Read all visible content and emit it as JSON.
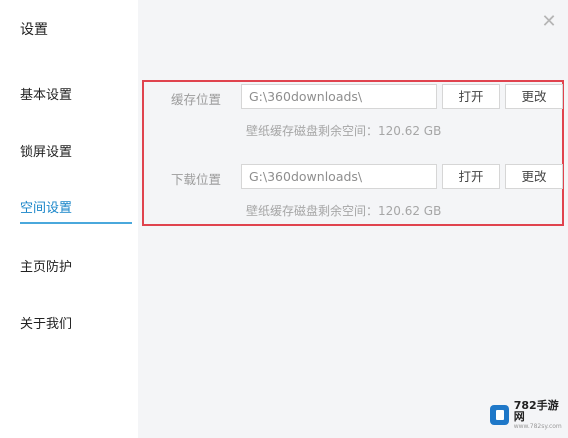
{
  "window": {
    "title": "设置",
    "close_icon": "close-icon"
  },
  "sidebar": {
    "items": [
      {
        "label": "基本设置"
      },
      {
        "label": "锁屏设置"
      },
      {
        "label": "空间设置"
      },
      {
        "label": "主页防护"
      },
      {
        "label": "关于我们"
      }
    ]
  },
  "storage": {
    "cache": {
      "label": "缓存位置",
      "path": "G:\\360downloads\\",
      "open_label": "打开",
      "change_label": "更改",
      "info": "壁纸缓存磁盘剩余空间：120.62 GB"
    },
    "download": {
      "label": "下载位置",
      "path": "G:\\360downloads\\",
      "open_label": "打开",
      "change_label": "更改",
      "info": "壁纸缓存磁盘剩余空间：120.62 GB"
    }
  },
  "watermark": {
    "main": "782手游网",
    "sub": "www.782sy.com"
  },
  "colors": {
    "accent": "#1a86c9",
    "highlight_border": "#e0434e",
    "content_bg": "#f4f5f7"
  }
}
